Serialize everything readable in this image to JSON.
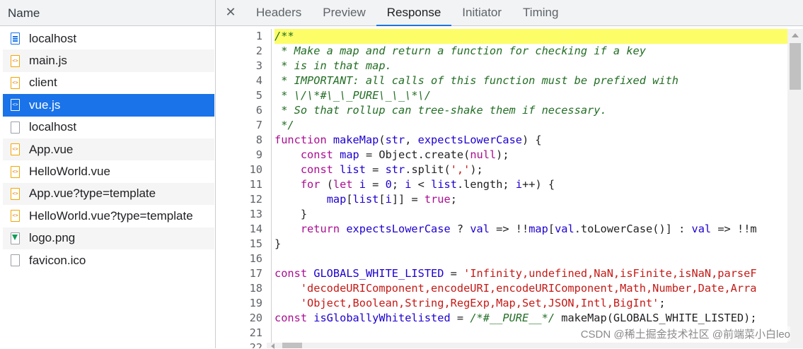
{
  "left": {
    "header": "Name",
    "requests": [
      {
        "name": "localhost",
        "icon": "document-icon"
      },
      {
        "name": "main.js",
        "icon": "script-icon"
      },
      {
        "name": "client",
        "icon": "script-icon"
      },
      {
        "name": "vue.js",
        "icon": "script-icon",
        "selected": true
      },
      {
        "name": "localhost",
        "icon": "file-icon"
      },
      {
        "name": "App.vue",
        "icon": "script-icon"
      },
      {
        "name": "HelloWorld.vue",
        "icon": "script-icon"
      },
      {
        "name": "App.vue?type=template",
        "icon": "script-icon"
      },
      {
        "name": "HelloWorld.vue?type=template",
        "icon": "script-icon"
      },
      {
        "name": "logo.png",
        "icon": "image-icon"
      },
      {
        "name": "favicon.ico",
        "icon": "file-icon"
      }
    ]
  },
  "tabs": {
    "close": "✕",
    "items": [
      "Headers",
      "Preview",
      "Response",
      "Initiator",
      "Timing"
    ],
    "active": "Response"
  },
  "code": {
    "lines": [
      {
        "n": "1",
        "hl": true,
        "t": [
          [
            "c-com",
            "/**"
          ]
        ]
      },
      {
        "n": "2",
        "t": [
          [
            "c-com",
            " * Make a map and return a function for checking if a key"
          ]
        ]
      },
      {
        "n": "3",
        "t": [
          [
            "c-com",
            " * is in that map."
          ]
        ]
      },
      {
        "n": "4",
        "t": [
          [
            "c-com",
            " * IMPORTANT: all calls of this function must be prefixed with"
          ]
        ]
      },
      {
        "n": "5",
        "t": [
          [
            "c-com",
            " * \\/\\*#\\_\\_PURE\\_\\_\\*\\/"
          ]
        ]
      },
      {
        "n": "6",
        "t": [
          [
            "c-com",
            " * So that rollup can tree-shake them if necessary."
          ]
        ]
      },
      {
        "n": "7",
        "t": [
          [
            "c-com",
            " */"
          ]
        ]
      },
      {
        "n": "8",
        "t": [
          [
            "c-kw",
            "function "
          ],
          [
            "c-fn",
            "makeMap"
          ],
          [
            "c-plain",
            "("
          ],
          [
            "c-var",
            "str"
          ],
          [
            "c-plain",
            ", "
          ],
          [
            "c-var",
            "expectsLowerCase"
          ],
          [
            "c-plain",
            ") {"
          ]
        ]
      },
      {
        "n": "9",
        "t": [
          [
            "c-plain",
            "    "
          ],
          [
            "c-kw",
            "const "
          ],
          [
            "c-var",
            "map"
          ],
          [
            "c-plain",
            " = Object.create("
          ],
          [
            "c-lit",
            "null"
          ],
          [
            "c-plain",
            ");"
          ]
        ]
      },
      {
        "n": "10",
        "t": [
          [
            "c-plain",
            "    "
          ],
          [
            "c-kw",
            "const "
          ],
          [
            "c-var",
            "list"
          ],
          [
            "c-plain",
            " = "
          ],
          [
            "c-var",
            "str"
          ],
          [
            "c-plain",
            ".split("
          ],
          [
            "c-str",
            "','"
          ],
          [
            "c-plain",
            ");"
          ]
        ]
      },
      {
        "n": "11",
        "t": [
          [
            "c-plain",
            "    "
          ],
          [
            "c-kw",
            "for "
          ],
          [
            "c-plain",
            "("
          ],
          [
            "c-kw",
            "let "
          ],
          [
            "c-var",
            "i"
          ],
          [
            "c-plain",
            " = "
          ],
          [
            "c-fn",
            "0"
          ],
          [
            "c-plain",
            "; "
          ],
          [
            "c-var",
            "i"
          ],
          [
            "c-plain",
            " < "
          ],
          [
            "c-var",
            "list"
          ],
          [
            "c-plain",
            ".length; "
          ],
          [
            "c-var",
            "i"
          ],
          [
            "c-plain",
            "++) {"
          ]
        ]
      },
      {
        "n": "12",
        "t": [
          [
            "c-plain",
            "        "
          ],
          [
            "c-var",
            "map"
          ],
          [
            "c-plain",
            "["
          ],
          [
            "c-var",
            "list"
          ],
          [
            "c-plain",
            "["
          ],
          [
            "c-var",
            "i"
          ],
          [
            "c-plain",
            "]] = "
          ],
          [
            "c-lit",
            "true"
          ],
          [
            "c-plain",
            ";"
          ]
        ]
      },
      {
        "n": "13",
        "t": [
          [
            "c-plain",
            "    }"
          ]
        ]
      },
      {
        "n": "14",
        "t": [
          [
            "c-plain",
            "    "
          ],
          [
            "c-kw",
            "return "
          ],
          [
            "c-var",
            "expectsLowerCase"
          ],
          [
            "c-plain",
            " ? "
          ],
          [
            "c-var",
            "val"
          ],
          [
            "c-plain",
            " => !!"
          ],
          [
            "c-var",
            "map"
          ],
          [
            "c-plain",
            "["
          ],
          [
            "c-var",
            "val"
          ],
          [
            "c-plain",
            ".toLowerCase()] : "
          ],
          [
            "c-var",
            "val"
          ],
          [
            "c-plain",
            " => !!m"
          ]
        ]
      },
      {
        "n": "15",
        "t": [
          [
            "c-plain",
            "}"
          ]
        ]
      },
      {
        "n": "16",
        "t": [
          [
            "c-plain",
            ""
          ]
        ]
      },
      {
        "n": "17",
        "t": [
          [
            "c-kw",
            "const "
          ],
          [
            "c-var",
            "GLOBALS_WHITE_LISTED"
          ],
          [
            "c-plain",
            " = "
          ],
          [
            "c-str",
            "'Infinity,undefined,NaN,isFinite,isNaN,parseF"
          ]
        ]
      },
      {
        "n": "18",
        "t": [
          [
            "c-plain",
            "    "
          ],
          [
            "c-str",
            "'decodeURIComponent,encodeURI,encodeURIComponent,Math,Number,Date,Arra"
          ]
        ]
      },
      {
        "n": "19",
        "t": [
          [
            "c-plain",
            "    "
          ],
          [
            "c-str",
            "'Object,Boolean,String,RegExp,Map,Set,JSON,Intl,BigInt'"
          ],
          [
            "c-plain",
            ";"
          ]
        ]
      },
      {
        "n": "20",
        "t": [
          [
            "c-kw",
            "const "
          ],
          [
            "c-var",
            "isGloballyWhitelisted"
          ],
          [
            "c-plain",
            " = "
          ],
          [
            "c-com",
            "/*#__PURE__*/"
          ],
          [
            "c-plain",
            " makeMap(GLOBALS_WHITE_LISTED);"
          ]
        ]
      },
      {
        "n": "21",
        "t": [
          [
            "c-plain",
            ""
          ]
        ]
      },
      {
        "n": "22",
        "t": [
          [
            "c-plain",
            ""
          ]
        ]
      }
    ]
  },
  "watermark": "CSDN @稀土掘金技术社区 @前端菜小白leo"
}
